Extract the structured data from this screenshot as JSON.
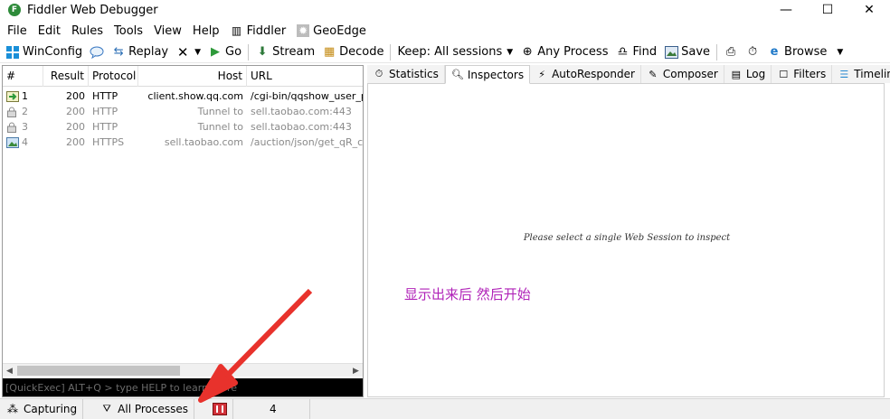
{
  "window": {
    "title": "Fiddler Web Debugger",
    "minimize": "—",
    "maximize": "☐",
    "close": "✕"
  },
  "menu": [
    "File",
    "Edit",
    "Rules",
    "Tools",
    "View",
    "Help",
    "Fiddler",
    "GeoEdge"
  ],
  "toolbar": {
    "winconfig": "WinConfig",
    "replay": "Replay",
    "go": "Go",
    "stream": "Stream",
    "decode": "Decode",
    "keep": "Keep: All sessions",
    "any_process": "Any Process",
    "find": "Find",
    "save": "Save",
    "browse": "Browse"
  },
  "sessions": {
    "headers": [
      "#",
      "Result",
      "Protocol",
      "Host",
      "URL"
    ],
    "rows": [
      {
        "num": "1",
        "result": "200",
        "protocol": "HTTP",
        "host": "client.show.qq.com",
        "url": "/cgi-bin/qqshow_user_pro"
      },
      {
        "num": "2",
        "result": "200",
        "protocol": "HTTP",
        "host": "Tunnel to",
        "url": "sell.taobao.com:443"
      },
      {
        "num": "3",
        "result": "200",
        "protocol": "HTTP",
        "host": "Tunnel to",
        "url": "sell.taobao.com:443"
      },
      {
        "num": "4",
        "result": "200",
        "protocol": "HTTPS",
        "host": "sell.taobao.com",
        "url": "/auction/json/get_qR_coo"
      }
    ]
  },
  "quickexec": "[QuickExec] ALT+Q > type HELP to learn more",
  "tabs": [
    "Statistics",
    "Inspectors",
    "AutoResponder",
    "Composer",
    "Log",
    "Filters",
    "Timeline"
  ],
  "inspector": {
    "message": "Please select a single Web Session to inspect",
    "annotation": "显示出来后 然后开始"
  },
  "status": {
    "capturing": "Capturing",
    "processes": "All Processes",
    "count": "4"
  },
  "colors": {
    "annotation": "#b022b8",
    "arrow": "#e8322c"
  }
}
